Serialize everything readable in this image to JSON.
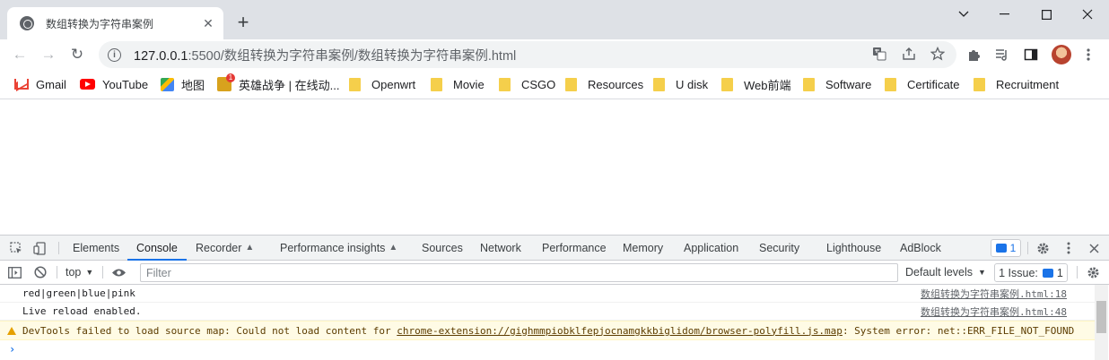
{
  "browser": {
    "tab_title": "数组转换为字符串案例",
    "tab_close": "✕",
    "new_tab": "+",
    "window_controls": {
      "minimize": "—",
      "maximize": "☐",
      "close": "✕"
    }
  },
  "toolbar": {
    "back": "←",
    "forward": "→",
    "reload": "↻",
    "url_host": "127.0.0.1",
    "url_rest": ":5500/数组转换为字符串案例/数组转换为字符串案例.html",
    "icons": [
      "translate-icon",
      "share-icon",
      "star-icon",
      "extensions-icon",
      "reading-list-icon",
      "side-panel-icon",
      "avatar",
      "menu-icon"
    ]
  },
  "bookmarks": [
    {
      "label": "Gmail",
      "icon": "gmail-icon"
    },
    {
      "label": "YouTube",
      "icon": "youtube-icon"
    },
    {
      "label": "地图",
      "icon": "maps-icon"
    },
    {
      "label": "英雄战争 | 在线动...",
      "icon": "game-icon"
    },
    {
      "label": "Openwrt",
      "icon": "folder-icon"
    },
    {
      "label": "Movie",
      "icon": "folder-icon"
    },
    {
      "label": "CSGO",
      "icon": "folder-icon"
    },
    {
      "label": "Resources",
      "icon": "folder-icon"
    },
    {
      "label": "U disk",
      "icon": "folder-icon"
    },
    {
      "label": "Web前端",
      "icon": "folder-icon"
    },
    {
      "label": "Software",
      "icon": "folder-icon"
    },
    {
      "label": "Certificate",
      "icon": "folder-icon"
    },
    {
      "label": "Recruitment",
      "icon": "folder-icon"
    }
  ],
  "devtools": {
    "tabs": [
      "Elements",
      "Console",
      "Recorder",
      "Performance insights",
      "Sources",
      "Network",
      "Performance",
      "Memory",
      "Application",
      "Security",
      "Lighthouse",
      "AdBlock"
    ],
    "active_tab": "Console",
    "issues_count": "1",
    "context": "top",
    "filter_placeholder": "Filter",
    "levels": "Default levels",
    "issues_label": "1 Issue:",
    "issues_label_count": "1",
    "console_lines": [
      {
        "message": "red|green|blue|pink",
        "source": "数组转换为字符串案例.html:18"
      },
      {
        "message": "Live reload enabled.",
        "source": "数组转换为字符串案例.html:48"
      }
    ],
    "warning": {
      "prefix": "DevTools failed to load source map: Could not load content for ",
      "link": "chrome-extension://gighmmpiobklfepjocnamgkkbiglidom/browser-polyfill.js.map",
      "suffix": ": System error: net::ERR_FILE_NOT_FOUND"
    },
    "prompt": "›"
  }
}
